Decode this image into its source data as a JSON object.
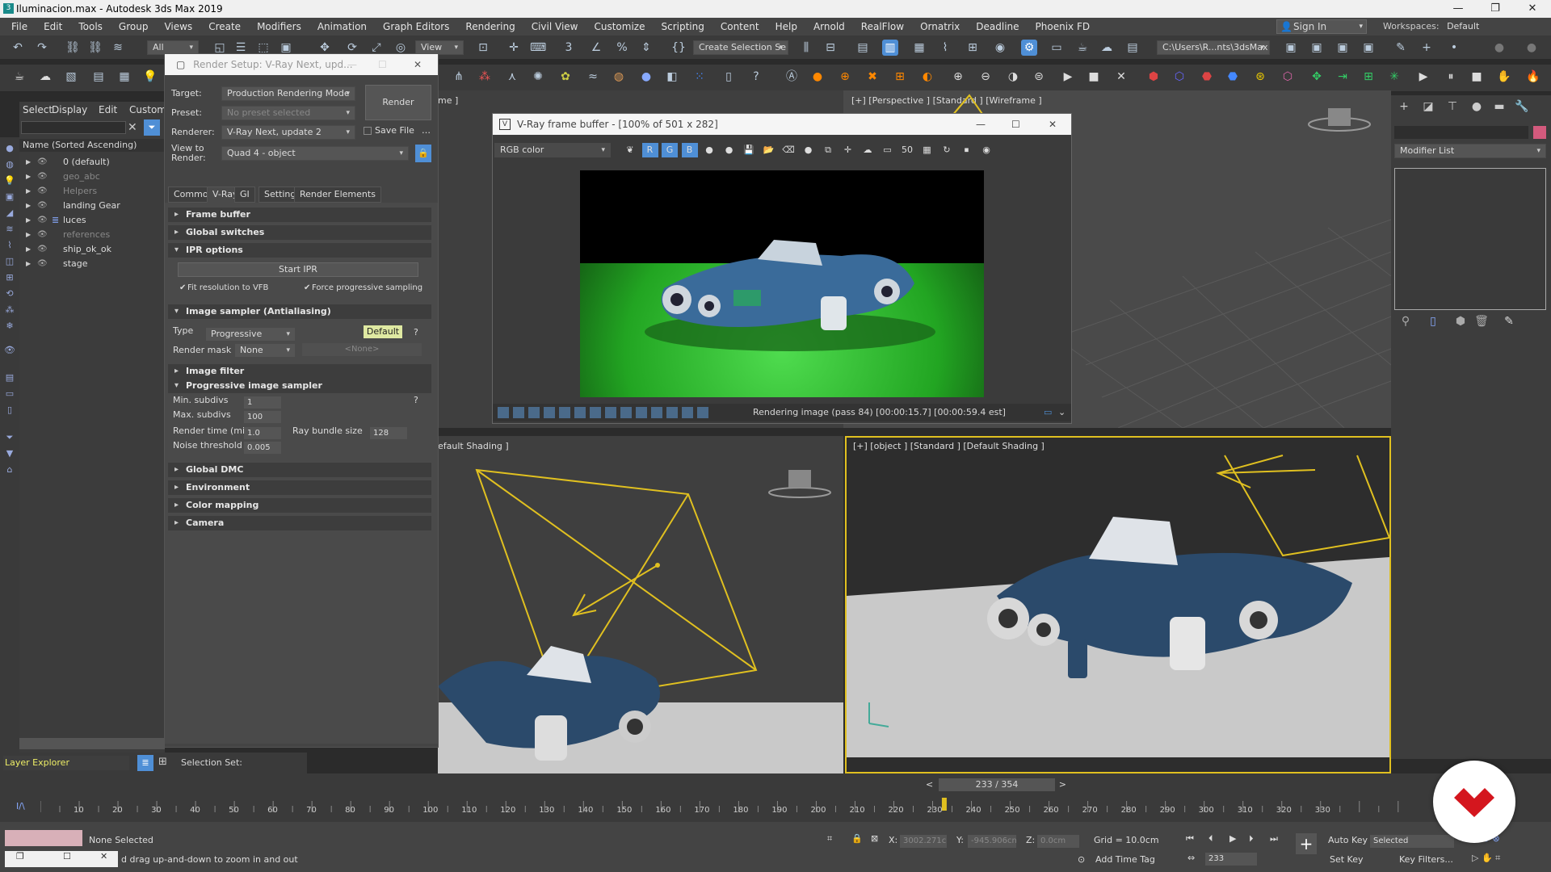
{
  "window": {
    "title": "Iluminacion.max - Autodesk 3ds Max 2019"
  },
  "menu": [
    "File",
    "Edit",
    "Tools",
    "Group",
    "Views",
    "Create",
    "Modifiers",
    "Animation",
    "Graph Editors",
    "Rendering",
    "Civil View",
    "Customize",
    "Scripting",
    "Content",
    "Help",
    "Arnold",
    "RealFlow",
    "Ornatrix",
    "Deadline",
    "Phoenix FD"
  ],
  "signin": "Sign In",
  "workspaces": "Workspaces:",
  "workspace_value": "Default",
  "toolbar": {
    "filter_value": "All",
    "view_value": "View",
    "create_selection": "Create Selection Se",
    "path_value": "C:\\Users\\R...nts\\3dsMax"
  },
  "scene_explorer": {
    "tabs": [
      "Select",
      "Display",
      "Edit",
      "Custom"
    ],
    "column_header": "Name (Sorted Ascending)",
    "items": [
      "0 (default)",
      "geo_abc",
      "Helpers",
      "landing Gear",
      "luces",
      "references",
      "ship_ok_ok",
      "stage"
    ],
    "footer_label": "Layer Explorer",
    "selection_set": "Selection Set:"
  },
  "render_setup": {
    "title": "Render Setup: V-Ray Next, upd...",
    "target_label": "Target:",
    "target_value": "Production Rendering Mode",
    "preset_label": "Preset:",
    "preset_value": "No preset selected",
    "renderer_label": "Renderer:",
    "renderer_value": "V-Ray Next, update 2",
    "save_file": "Save File",
    "view_label_1": "View to",
    "view_label_2": "Render:",
    "view_value": "Quad 4 - object",
    "render_button": "Render",
    "tabs": [
      "Common",
      "V-Ray",
      "GI",
      "Settings",
      "Render Elements"
    ],
    "sections": {
      "frame_buffer": "Frame buffer",
      "global_switches": "Global switches",
      "ipr_options": "IPR options",
      "image_sampler": "Image sampler (Antialiasing)",
      "image_filter": "Image filter",
      "progressive_sampler": "Progressive image sampler",
      "global_dmc": "Global DMC",
      "environment": "Environment",
      "color_mapping": "Color mapping",
      "camera": "Camera"
    },
    "start_ipr": "Start IPR",
    "fit_resolution": "Fit resolution to VFB",
    "force_progressive": "Force progressive sampling",
    "type_label": "Type",
    "type_value": "Progressive",
    "default_button": "Default",
    "help": "?",
    "render_mask_label": "Render mask",
    "render_mask_value": "None",
    "render_mask_none": "<None>",
    "min_subdivs_label": "Min. subdivs",
    "min_subdivs": "1",
    "max_subdivs_label": "Max. subdivs",
    "max_subdivs": "100",
    "render_time_label": "Render time (min)",
    "render_time": "1.0",
    "ray_bundle_label": "Ray bundle size",
    "ray_bundle": "128",
    "noise_label": "Noise threshold",
    "noise": "0.005"
  },
  "vfb": {
    "title": "V-Ray frame buffer - [100% of 501 x 282]",
    "channel": "RGB color",
    "status": "Rendering image (pass 84) [00:00:15.7] [00:00:59.4 est]"
  },
  "viewports": {
    "top_left_label": "me ]",
    "top_right_label": "[+] [Perspective ] [Standard ] [Wireframe ]",
    "bottom_left_label": "efault Shading ]",
    "bottom_right_label": "[+] [object ] [Standard ] [Default Shading ]"
  },
  "right_panel": {
    "modifier_list": "Modifier List"
  },
  "timeline": {
    "frame_counter": "233 / 354",
    "ticks": [
      "10",
      "20",
      "30",
      "40",
      "50",
      "60",
      "70",
      "80",
      "90",
      "100",
      "110",
      "120",
      "130",
      "140",
      "150",
      "160",
      "170",
      "180",
      "190",
      "200",
      "210",
      "220",
      "230",
      "240",
      "250",
      "260",
      "270",
      "280",
      "290",
      "300",
      "310",
      "320",
      "330"
    ],
    "current_frame": 233,
    "total_frames": 354
  },
  "status": {
    "none_selected": "None Selected",
    "hint": "d drag up-and-down to zoom in and out",
    "x_label": "X:",
    "x_value": "3002.271c",
    "y_label": "Y:",
    "y_value": "-945.906cn",
    "z_label": "Z:",
    "z_value": "0.0cm",
    "grid": "Grid = 10.0cm",
    "add_time_tag": "Add Time Tag",
    "auto_key": "Auto Key",
    "set_key": "Set Key",
    "selected": "Selected",
    "key_filters": "Key Filters...",
    "frame_field": "233"
  },
  "colors": {
    "accent": "#4f8fd6",
    "render_green": "#2fbf2f",
    "ship_blue": "#2b4a6b",
    "wire_yellow": "#e0c020",
    "logo_red": "#d4161e"
  }
}
